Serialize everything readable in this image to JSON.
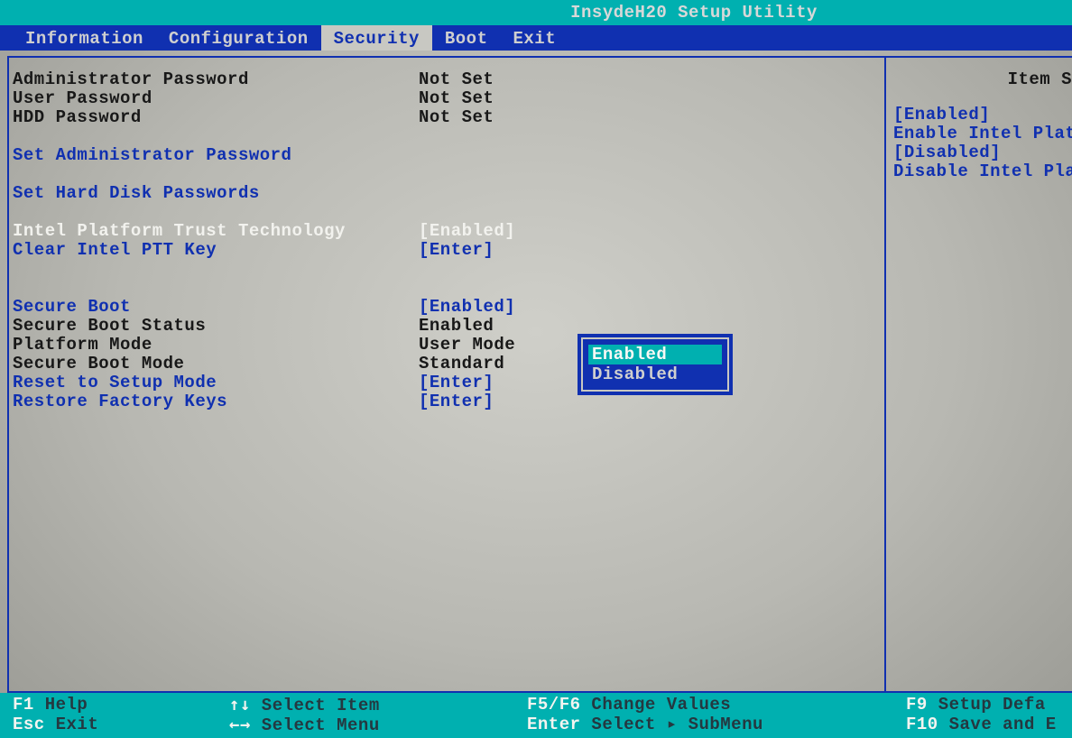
{
  "title": "InsydeH20 Setup Utility",
  "menu": {
    "information": "Information",
    "configuration": "Configuration",
    "security": "Security",
    "boot": "Boot",
    "exit": "Exit"
  },
  "rows": {
    "admin_pw_label": "Administrator Password",
    "admin_pw_value": "Not Set",
    "user_pw_label": "User Password",
    "user_pw_value": "Not Set",
    "hdd_pw_label": "HDD Password",
    "hdd_pw_value": "Not Set",
    "set_admin_pw": "Set Administrator Password",
    "set_hdd_pw": "Set Hard Disk Passwords",
    "iptt_label": "Intel Platform Trust Technology",
    "iptt_value": "[Enabled]",
    "clear_ptt_label": "Clear Intel PTT Key",
    "clear_ptt_value": "[Enter]",
    "secure_boot_label": "Secure Boot",
    "secure_boot_value": "[Enabled]",
    "sb_status_label": "Secure Boot Status",
    "sb_status_value": "Enabled",
    "platform_mode_label": "Platform Mode",
    "platform_mode_value": "User Mode",
    "sb_mode_label": "Secure Boot Mode",
    "sb_mode_value": "Standard",
    "reset_setup_label": "Reset to Setup Mode",
    "reset_setup_value": "[Enter]",
    "restore_keys_label": "Restore Factory Keys",
    "restore_keys_value": "[Enter]"
  },
  "help": {
    "title": "Item S",
    "l1": "[Enabled]",
    "l2": "Enable Intel Plat",
    "l3": "[Disabled]",
    "l4": "Disable Intel Pla"
  },
  "popup": {
    "opt_enabled": "Enabled",
    "opt_disabled": "Disabled"
  },
  "footer": {
    "f1_key": "F1",
    "f1_lbl": "Help",
    "esc_key": "Esc",
    "esc_lbl": "Exit",
    "updown_key": "↑↓",
    "updown_lbl": "Select Item",
    "leftright_key": "←→",
    "leftright_lbl": "Select Menu",
    "f5f6_key": "F5/F6",
    "f5f6_lbl": "Change Values",
    "enter_key": "Enter",
    "enter_lbl": "Select ▸ SubMenu",
    "f9_key": "F9",
    "f9_lbl": "Setup Defa",
    "f10_key": "F10",
    "f10_lbl": "Save and E"
  }
}
